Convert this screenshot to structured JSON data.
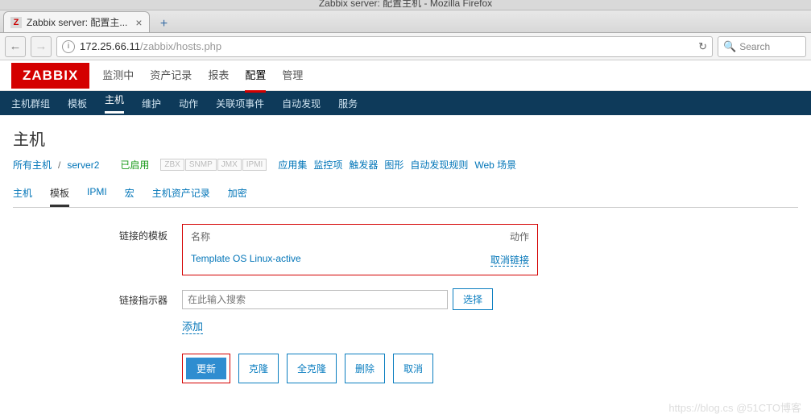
{
  "window": {
    "title": "Zabbix server: 配置主机 - Mozilla Firefox"
  },
  "browser": {
    "tab_title": "Zabbix server: 配置主...",
    "url_host": "172.25.66.11",
    "url_path": "/zabbix/hosts.php",
    "search_placeholder": "Search"
  },
  "header": {
    "logo": "ZABBIX",
    "menu": [
      "监测中",
      "资产记录",
      "报表",
      "配置",
      "管理"
    ],
    "active_index": 3
  },
  "subnav": {
    "items": [
      "主机群组",
      "模板",
      "主机",
      "维护",
      "动作",
      "关联项事件",
      "自动发现",
      "服务"
    ],
    "active_index": 2
  },
  "page": {
    "title": "主机"
  },
  "breadcrumb": {
    "all_hosts": "所有主机",
    "host": "server2",
    "enabled": "已启用",
    "badges": [
      "ZBX",
      "SNMP",
      "JMX",
      "IPMI"
    ],
    "links": [
      "应用集",
      "监控项",
      "触发器",
      "图形",
      "自动发现规则",
      "Web 场景"
    ]
  },
  "tabs2": {
    "items": [
      "主机",
      "模板",
      "IPMI",
      "宏",
      "主机资产记录",
      "加密"
    ],
    "active_index": 1
  },
  "form": {
    "linked_templates_label": "链接的模板",
    "col_name": "名称",
    "col_action": "动作",
    "template_name": "Template OS Linux-active",
    "unlink": "取消链接",
    "link_new_label": "链接指示器",
    "search_placeholder": "在此输入搜索",
    "select_btn": "选择",
    "add_link": "添加"
  },
  "buttons": {
    "update": "更新",
    "clone": "克隆",
    "full_clone": "全克隆",
    "delete": "删除",
    "cancel": "取消"
  },
  "watermark": "https://blog.cs   @51CTO博客"
}
